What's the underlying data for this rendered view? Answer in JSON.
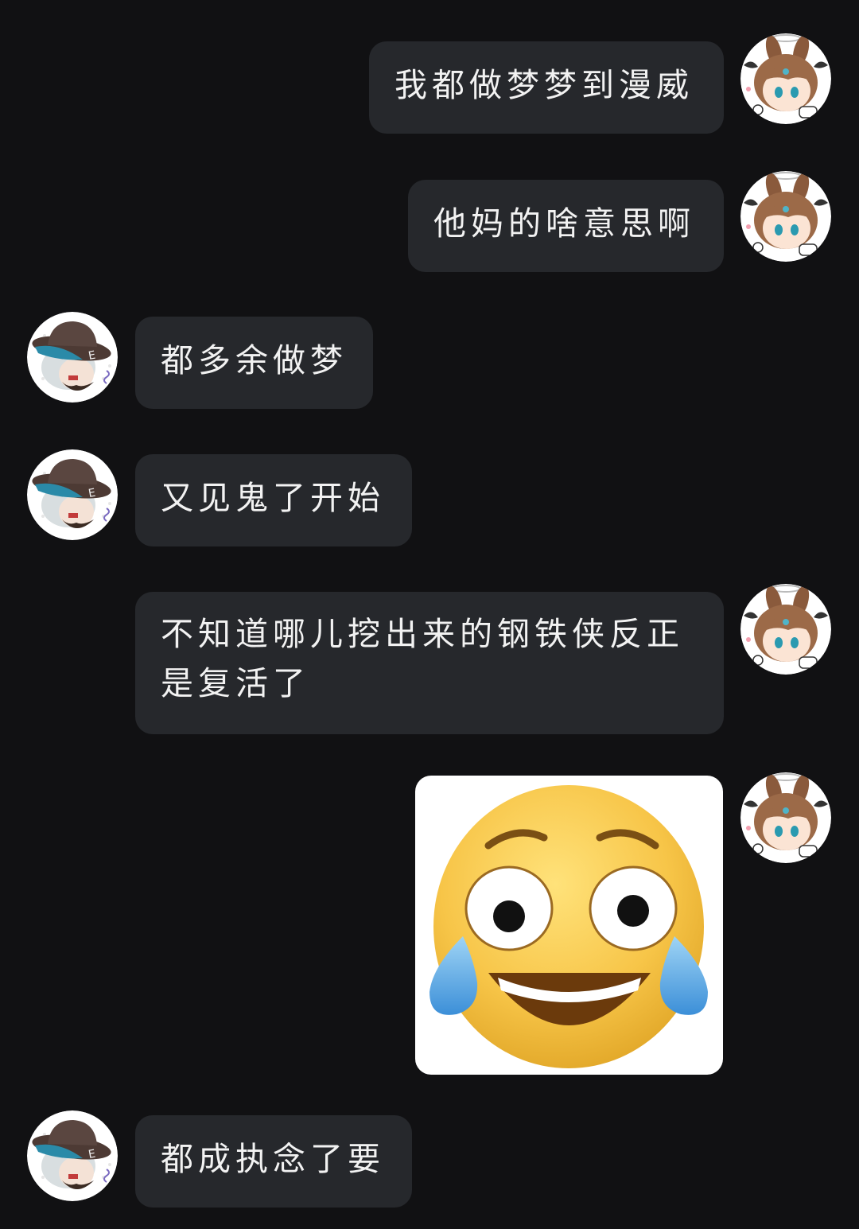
{
  "chat": {
    "messages": [
      {
        "sender": "me",
        "type": "text",
        "text": "我都做梦梦到漫威"
      },
      {
        "sender": "me",
        "type": "text",
        "text": "他妈的啥意思啊"
      },
      {
        "sender": "friend",
        "type": "text",
        "text": "都多余做梦"
      },
      {
        "sender": "friend",
        "type": "text",
        "text": "又见鬼了开始"
      },
      {
        "sender": "me",
        "type": "text",
        "text": "不知道哪儿挖出来的钢铁侠反正是复活了"
      },
      {
        "sender": "me",
        "type": "image",
        "icon": "laughing-crying-face-emoji"
      },
      {
        "sender": "friend",
        "type": "text",
        "text": "都成执念了要"
      }
    ]
  },
  "colors": {
    "background": "#111113",
    "bubble": "#26282c",
    "bubble_text": "#f2f2f2"
  }
}
